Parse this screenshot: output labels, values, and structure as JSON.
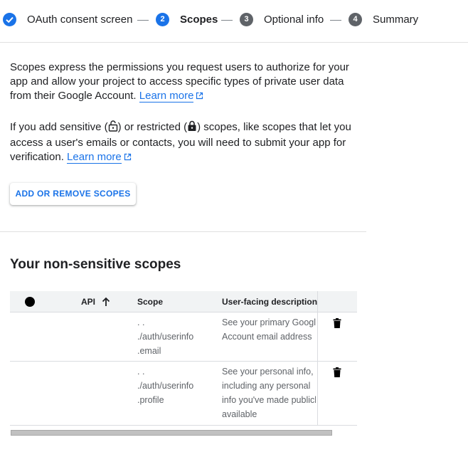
{
  "stepper": {
    "steps": [
      {
        "label": "OAuth consent screen",
        "status": "complete",
        "number": ""
      },
      {
        "label": "Scopes",
        "status": "active",
        "number": "2"
      },
      {
        "label": "Optional info",
        "status": "pending",
        "number": "3"
      },
      {
        "label": "Summary",
        "status": "pending",
        "number": "4"
      }
    ]
  },
  "intro": {
    "paragraph1": "Scopes express the permissions you request users to authorize for your app and allow your project to access specific types of private user data from their Google Account.",
    "paragraph2_part1": "If you add sensitive (",
    "paragraph2_part2": ") or restricted (",
    "paragraph2_part3": ") scopes, like scopes that let you access a user's emails or contacts, you will need to submit your app for verification.",
    "learn_more": "Learn more"
  },
  "add_scopes_button": "ADD OR REMOVE SCOPES",
  "section_title": "Your non-sensitive scopes",
  "table": {
    "columns": {
      "api": "API",
      "scope": "Scope",
      "description": "User-facing description"
    },
    "rows": [
      {
        "scope": [
          ". .",
          "./auth/userinfo",
          ".email"
        ],
        "description": [
          "See your primary Google",
          "Account email address"
        ]
      },
      {
        "scope": [
          ". .",
          "./auth/userinfo",
          ".profile"
        ],
        "description": [
          "See your personal info,",
          "including any personal",
          "info you've made publicly",
          "available"
        ]
      }
    ]
  },
  "colors": {
    "accent": "#1a73e8",
    "pending_step": "#5f6368",
    "text": "#202124",
    "muted_text": "#5f6368"
  },
  "icons": {
    "complete_step": "check-circle-icon",
    "sort": "arrow-upward-icon",
    "delete": "trash-icon",
    "external_link": "external-link-icon",
    "sensitive": "lock-open-icon",
    "restricted": "lock-icon"
  }
}
